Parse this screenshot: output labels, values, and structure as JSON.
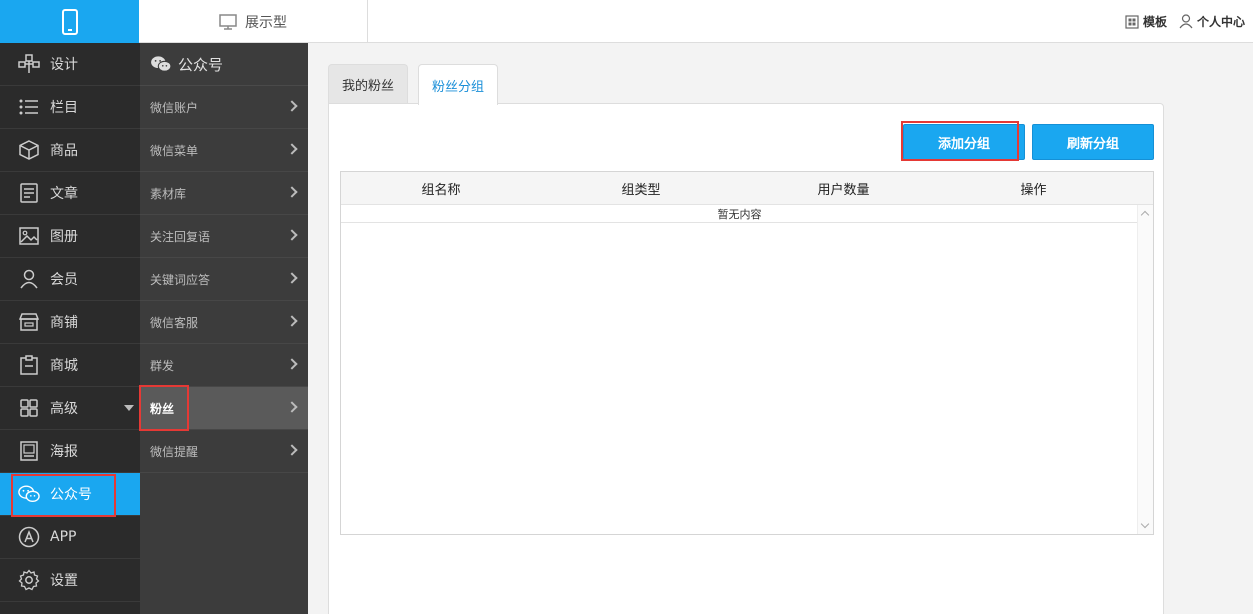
{
  "topbar": {
    "view_label": "展示型",
    "template_label": "模板",
    "user_center_label": "个人中心"
  },
  "leftnav": {
    "items": [
      {
        "label": "设计",
        "icon": "design-icon"
      },
      {
        "label": "栏目",
        "icon": "list-icon"
      },
      {
        "label": "商品",
        "icon": "box-icon"
      },
      {
        "label": "文章",
        "icon": "document-icon"
      },
      {
        "label": "图册",
        "icon": "image-icon"
      },
      {
        "label": "会员",
        "icon": "user-icon"
      },
      {
        "label": "商铺",
        "icon": "store-icon"
      },
      {
        "label": "商城",
        "icon": "clipboard-icon"
      },
      {
        "label": "高级",
        "icon": "grid-icon"
      },
      {
        "label": "海报",
        "icon": "poster-icon"
      },
      {
        "label": "公众号",
        "icon": "wechat-icon"
      },
      {
        "label": "APP",
        "icon": "app-icon"
      },
      {
        "label": "设置",
        "icon": "gear-icon"
      }
    ],
    "active_index": 10
  },
  "subnav": {
    "title": "公众号",
    "items": [
      {
        "label": "微信账户"
      },
      {
        "label": "微信菜单"
      },
      {
        "label": "素材库"
      },
      {
        "label": "关注回复语"
      },
      {
        "label": "关键词应答"
      },
      {
        "label": "微信客服"
      },
      {
        "label": "群发"
      },
      {
        "label": "粉丝"
      },
      {
        "label": "微信提醒"
      }
    ],
    "active_index": 7
  },
  "main": {
    "tabs": [
      {
        "label": "我的粉丝"
      },
      {
        "label": "粉丝分组"
      }
    ],
    "active_tab": 1,
    "buttons": {
      "add": "添加分组",
      "refresh": "刷新分组"
    },
    "table": {
      "columns": [
        "组名称",
        "组类型",
        "用户数量",
        "操作"
      ],
      "empty_text": "暂无内容"
    }
  },
  "colors": {
    "accent": "#1aa7f0",
    "highlight_box": "#e53935",
    "nav_bg": "#2b2b2b",
    "subnav_bg": "#3c3c3c"
  }
}
